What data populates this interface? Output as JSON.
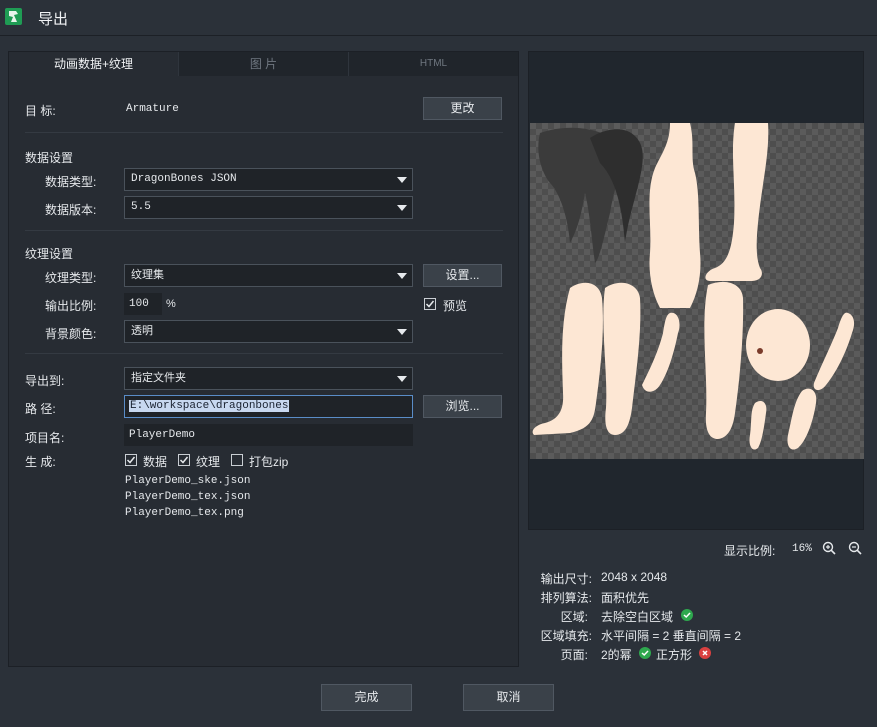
{
  "window": {
    "title": "导出",
    "icon": "dragonbones-app-icon"
  },
  "tabs": [
    {
      "label": "动画数据+纹理",
      "active": true
    },
    {
      "label": "图 片",
      "active": false
    },
    {
      "label": "HTML",
      "active": false
    }
  ],
  "target": {
    "label": "目 标:",
    "value": "Armature",
    "change_button": "更改"
  },
  "data_settings": {
    "heading": "数据设置",
    "type_label": "数据类型:",
    "type_value": "DragonBones JSON",
    "version_label": "数据版本:",
    "version_value": "5.5"
  },
  "texture_settings": {
    "heading": "纹理设置",
    "type_label": "纹理类型:",
    "type_value": "纹理集",
    "settings_button": "设置...",
    "scale_label": "输出比例:",
    "scale_value": "100",
    "scale_unit": "%",
    "preview_label": "预览",
    "preview_checked": true,
    "bg_label": "背景颜色:",
    "bg_value": "透明"
  },
  "export": {
    "to_label": "导出到:",
    "to_value": "指定文件夹",
    "path_label": "路 径:",
    "path_value": "E:\\workspace\\dragonbones",
    "browse_button": "浏览...",
    "project_label": "项目名:",
    "project_value": "PlayerDemo",
    "generate_label": "生 成:",
    "options": [
      {
        "label": "数据",
        "checked": true
      },
      {
        "label": "纹理",
        "checked": true
      },
      {
        "label": "打包zip",
        "checked": false
      }
    ],
    "files": [
      "PlayerDemo_ske.json",
      "PlayerDemo_tex.json",
      "PlayerDemo_tex.png"
    ]
  },
  "preview": {
    "zoom_label": "显示比例:",
    "zoom_value": "16%",
    "info": {
      "size_label": "输出尺寸:",
      "size_value": "2048 x 2048",
      "algo_label": "排列算法:",
      "algo_value": "面积优先",
      "region_label": "区域:",
      "region_value": "去除空白区域",
      "padding_label": "区域填充:",
      "padding_value": "水平间隔 = 2 垂直间隔 = 2",
      "page_label": "页面:",
      "page_pow2": "2的幂",
      "page_square": "正方形"
    }
  },
  "footer": {
    "done_button": "完成",
    "cancel_button": "取消"
  },
  "colors": {
    "accent": "#5a8dc8",
    "ok": "#2ea84e",
    "error": "#d94040",
    "skin": "#fde7d4"
  }
}
